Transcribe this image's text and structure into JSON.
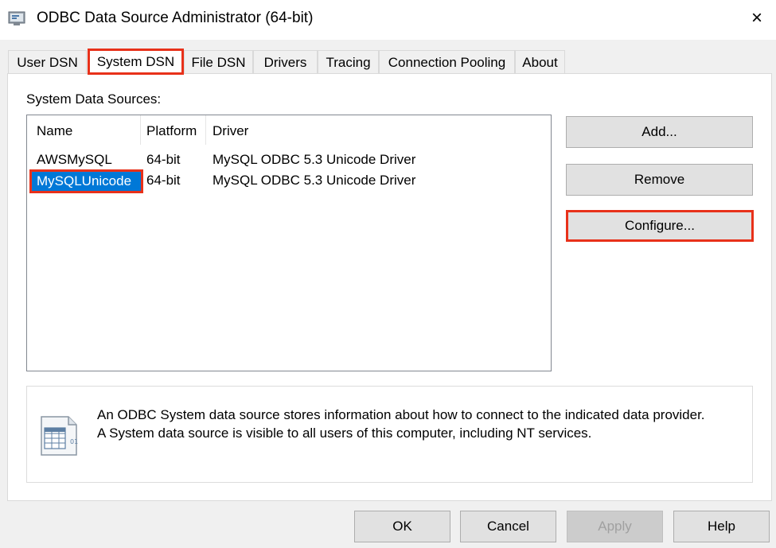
{
  "window": {
    "title": "ODBC Data Source Administrator (64-bit)",
    "close_glyph": "×"
  },
  "tabs": [
    {
      "label": "User DSN",
      "selected": false
    },
    {
      "label": "System DSN",
      "selected": true
    },
    {
      "label": "File DSN",
      "selected": false
    },
    {
      "label": "Drivers",
      "selected": false
    },
    {
      "label": "Tracing",
      "selected": false
    },
    {
      "label": "Connection Pooling",
      "selected": false
    },
    {
      "label": "About",
      "selected": false
    }
  ],
  "panel": {
    "group_label": "System Data Sources:",
    "columns": {
      "name": "Name",
      "platform": "Platform",
      "driver": "Driver"
    },
    "rows": [
      {
        "name": "AWSMySQL",
        "platform": "64-bit",
        "driver": "MySQL ODBC 5.3 Unicode Driver",
        "selected": false
      },
      {
        "name": "MySQLUnicode",
        "platform": "64-bit",
        "driver": "MySQL ODBC 5.3 Unicode Driver",
        "selected": true
      }
    ],
    "buttons": {
      "add": "Add...",
      "remove": "Remove",
      "configure": "Configure..."
    },
    "info": {
      "icon": "data-source-document-icon",
      "line1": "An ODBC System data source stores information about how to connect to the indicated data provider.",
      "line2": "A System data source is visible to all users of this computer, including NT services."
    }
  },
  "footer": {
    "ok": "OK",
    "cancel": "Cancel",
    "apply": "Apply",
    "help": "Help"
  },
  "colors": {
    "highlight_outline": "#e8311a",
    "selection": "#0078d7",
    "window_bg": "#f0f0f0"
  }
}
